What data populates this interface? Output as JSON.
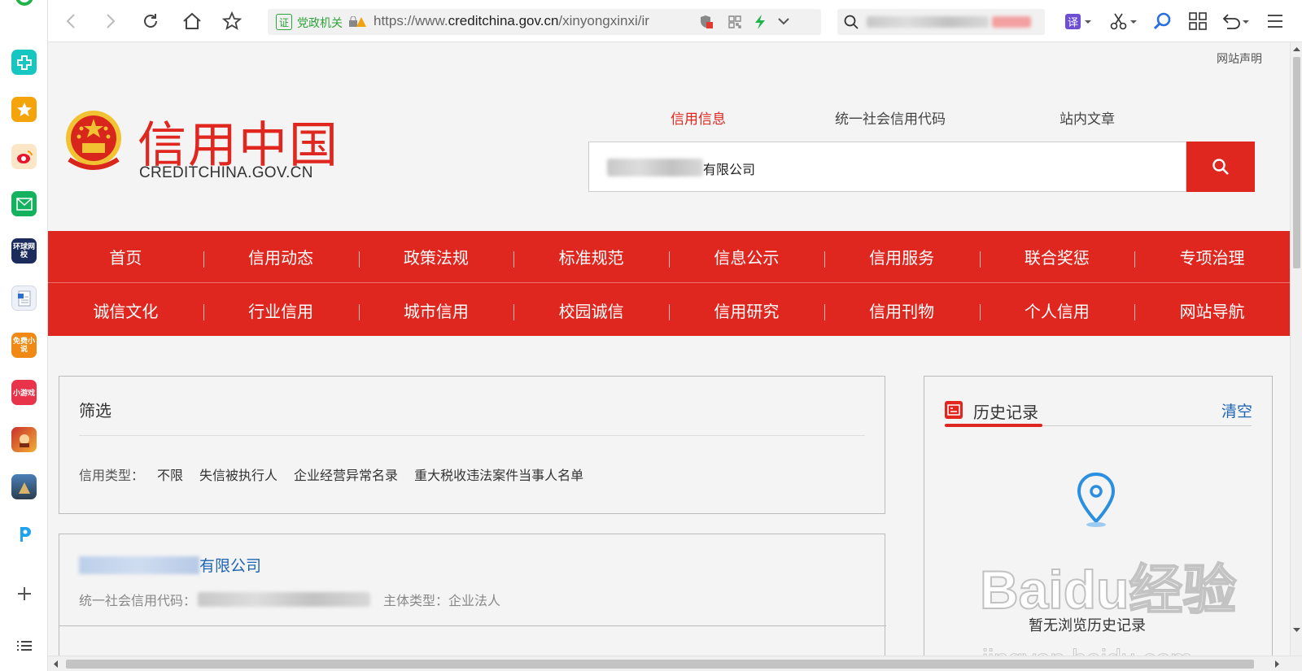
{
  "browser": {
    "url_tag": "党政机关",
    "url_prefix": "https://www.",
    "url_domain": "creditchina.gov.cn",
    "url_path": "/xinyongxinxi/ir",
    "badge": "证"
  },
  "dock": {
    "items": [
      "app-icon",
      "star-icon",
      "weibo-icon",
      "mail-icon",
      "globe-news-icon",
      "document-icon",
      "novel-icon",
      "game-icon",
      "hero-icon",
      "battle-icon",
      "p-icon"
    ],
    "labels": {
      "news": "环球网校",
      "novel": "免费小说",
      "tiny": "小游戏"
    }
  },
  "site": {
    "statement": "网站声明",
    "logo_cn": "信用中国",
    "logo_en": "CREDITCHINA.GOV.CN"
  },
  "search": {
    "tabs": [
      "信用信息",
      "统一社会信用代码",
      "站内文章"
    ],
    "value_suffix": "有限公司"
  },
  "nav": {
    "row1": [
      "首页",
      "信用动态",
      "政策法规",
      "标准规范",
      "信息公示",
      "信用服务",
      "联合奖惩",
      "专项治理"
    ],
    "row2": [
      "诚信文化",
      "行业信用",
      "城市信用",
      "校园诚信",
      "信用研究",
      "信用刊物",
      "个人信用",
      "网站导航"
    ]
  },
  "filter": {
    "title": "筛选",
    "label": "信用类型：",
    "options": [
      "不限",
      "失信被执行人",
      "企业经营异常名录",
      "重大税收违法案件当事人名单"
    ]
  },
  "result": {
    "name_suffix": "有限公司",
    "code_label": "统一社会信用代码：",
    "type_label": "主体类型：",
    "type_value": "企业法人"
  },
  "history": {
    "title": "历史记录",
    "clear": "清空",
    "empty": "暂无浏览历史记录"
  },
  "watermark": {
    "brand": "Baidu经验",
    "url": "jingyan.baidu.com"
  },
  "colors": {
    "brand_red": "#e0271f",
    "link_blue": "#1e64b4"
  }
}
